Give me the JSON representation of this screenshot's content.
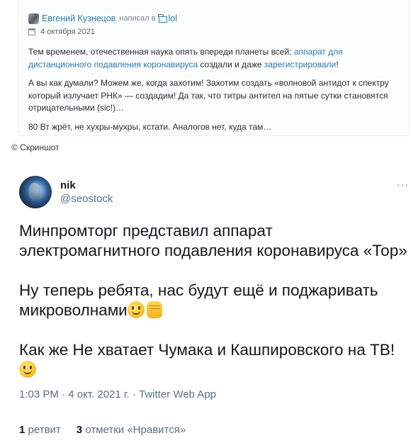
{
  "blog": {
    "author": "Евгений Кузнецов",
    "wrote_in": "написал в",
    "blog_name": "lol",
    "date": "4 октября 2021",
    "p1_before": "Тем временем, отечественная наука опять впереди планеты всей: ",
    "p1_link1_line1": "аппарат для",
    "p1_link1_line2": "дистанционного подавления коронавируса",
    "p1_middle": " создали и даже ",
    "p1_link2": "зарегистрировали",
    "p1_end": "!",
    "p2_line1": "А вы как думали? Можем же, когда захотим! Захотим создать «волновой антидот к спектру",
    "p2_line2": "который излучает РНК» — создадим! Да так, что титры антител на пятые сутки становятся",
    "p2_line3": "отрицательными (sic!)…",
    "p3": "80 Вт жрёт, не хухры-мухры, кстати. Аналогов нет, куда там…"
  },
  "caption": "© Скриншот",
  "tweet": {
    "name": "nik",
    "handle": "@seostock",
    "more": "···",
    "p1_line1": "Минпромторг представил аппарат",
    "p1_line2": "электромагнитного подавления коронавируса «Тор»",
    "p2_line1": "Ну теперь ребята, нас будут ещё и поджаривать",
    "p2_line2": "микроволнами",
    "p3_line1": "Как же Не хватает Чумака и Кашпировского на ТВ!",
    "meta": "1:03 PM · 4 окт. 2021 г. · Twitter Web App",
    "retweets_count": "1",
    "retweets_label": "ретвит",
    "likes_count": "3",
    "likes_label": "отметки «Нравится»",
    "emoji": [
      "smiling-face",
      "raised-fist",
      "smiling-face"
    ]
  }
}
